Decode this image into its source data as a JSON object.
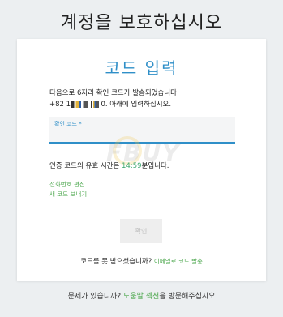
{
  "page": {
    "title": "계정을 보호하십시오"
  },
  "card": {
    "title": "코드 입력",
    "description_line1": "다음으로 6자리 확인 코드가 발송되었습니다",
    "phone_prefix": "+82 1",
    "phone_suffix": "0. 아래에 입력하십시오.",
    "field_label": "확인 코드 *",
    "field_value": "",
    "expiry_prefix": "인증 코드의 유효 시간은 ",
    "expiry_timer": "14:59",
    "expiry_suffix": "분입니다.",
    "edit_phone_link": "전화번호 편집",
    "resend_link": "새 코드 보내기",
    "confirm_button": "확인",
    "no_code_text": "코드를 못 받으셨습니까?",
    "email_code_link": "이메일로 코드 발송"
  },
  "footer": {
    "prefix": "문제가 있습니까? ",
    "help_link": "도움말 섹션",
    "suffix": "을 방문해주십시오"
  },
  "watermark": {
    "text": "FBUY"
  },
  "colors": {
    "accent_blue": "#2f8fc8",
    "link_green": "#4ea84f",
    "timer_green": "#3aa76d",
    "background": "#eceff1"
  }
}
